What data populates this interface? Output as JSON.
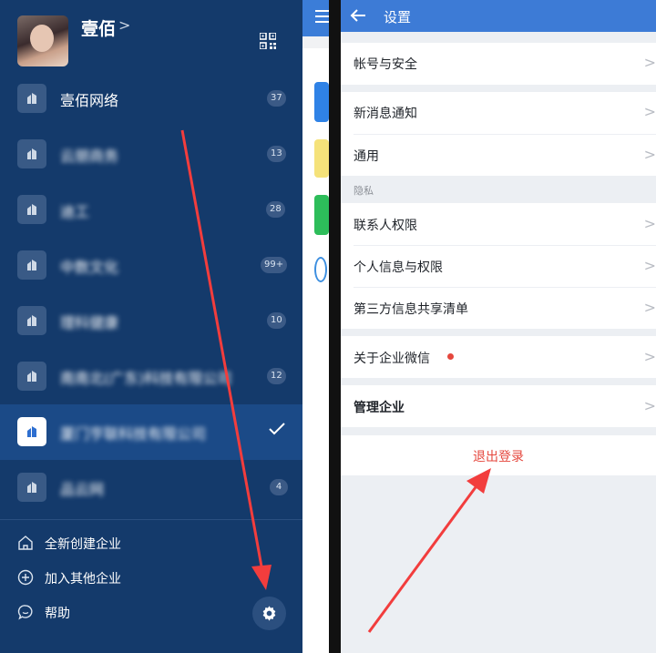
{
  "profile": {
    "name": "壹佰",
    "chevron": ">"
  },
  "organizations": [
    {
      "name": "壹佰网络",
      "badge": "37",
      "blurred": false,
      "active": false
    },
    {
      "name": "云朋商务",
      "badge": "13",
      "blurred": true,
      "active": false
    },
    {
      "name": "迪工",
      "badge": "28",
      "blurred": true,
      "active": false
    },
    {
      "name": "中数文化",
      "badge": "99+",
      "blurred": true,
      "active": false
    },
    {
      "name": "理科健康",
      "badge": "10",
      "blurred": true,
      "active": false
    },
    {
      "name": "南南北(广东)科技有限公司",
      "badge": "12",
      "blurred": true,
      "active": false
    },
    {
      "name": "厦门亨联科技有限公司",
      "badge": "",
      "blurred": true,
      "active": true
    },
    {
      "name": "品云网",
      "badge": "4",
      "blurred": true,
      "active": false
    }
  ],
  "menu": {
    "create": "全新创建企业",
    "join": "加入其他企业",
    "help": "帮助"
  },
  "settings": {
    "title": "设置",
    "rows": {
      "account_security": "帐号与安全",
      "notifications": "新消息通知",
      "general": "通用",
      "privacy_section": "隐私",
      "contact_permissions": "联系人权限",
      "personal_info": "个人信息与权限",
      "third_party": "第三方信息共享清单",
      "about": "关于企业微信",
      "manage": "管理企业"
    },
    "chevron": ">",
    "logout": "退出登录"
  },
  "colors": {
    "sidebar_bg": "#143a6b",
    "active_row": "#1b4a87",
    "header_blue": "#3d7bd6",
    "red_accent": "#e5473d",
    "arrow_red": "#f23d3d"
  },
  "icons": {
    "qr": "qr-code-icon",
    "org": "building-icon",
    "check": "checkmark-icon",
    "home": "home-icon",
    "plus": "plus-circle-icon",
    "help": "chat-bubble-icon",
    "settings": "gear-icon",
    "back": "back-arrow-icon"
  }
}
